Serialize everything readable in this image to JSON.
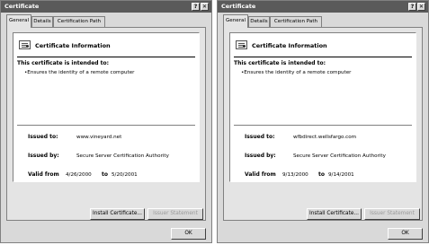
{
  "dialogs": [
    {
      "title": "Certificate",
      "help_glyph": "?",
      "close_glyph": "✕",
      "tabs": [
        "General",
        "Details",
        "Certification Path"
      ],
      "heading": "Certificate Information",
      "purpose_heading": "This certificate is intended to:",
      "purpose_item": "•Ensures the identity of a remote computer",
      "issued_to_label": "Issued to:",
      "issued_to_value": "www.vineyard.net",
      "issued_by_label": "Issued by:",
      "issued_by_value": "Secure Server Certification Authority",
      "valid_from_label": "Valid from",
      "valid_from_value": "4/26/2000",
      "valid_to_label": "to",
      "valid_to_value": "5/20/2001",
      "install_button": "Install Certificate...",
      "issuer_button": "Issuer Statement",
      "ok_button": "OK"
    },
    {
      "title": "Certificate",
      "help_glyph": "?",
      "close_glyph": "✕",
      "tabs": [
        "General",
        "Details",
        "Certification Path"
      ],
      "heading": "Certificate Information",
      "purpose_heading": "This certificate is intended to:",
      "purpose_item": "•Ensures the identity of a remote computer",
      "issued_to_label": "Issued to:",
      "issued_to_value": "wfbdirect.wellsfargo.com",
      "issued_by_label": "Issued by:",
      "issued_by_value": "Secure Server Certification Authority",
      "valid_from_label": "Valid from",
      "valid_from_value": "9/13/2000",
      "valid_to_label": "to",
      "valid_to_value": "9/14/2001",
      "install_button": "Install Certificate...",
      "issuer_button": "Issuer Statement",
      "ok_button": "OK"
    }
  ],
  "colors": {
    "titlebar": "#5a5a5a",
    "dialog_face": "#d9d9d9",
    "panel": "#e4e4e4",
    "info_box": "#ffffff",
    "disabled_text": "#9a9a9a"
  },
  "icons": [
    "certificate-icon",
    "help-icon",
    "close-icon"
  ]
}
